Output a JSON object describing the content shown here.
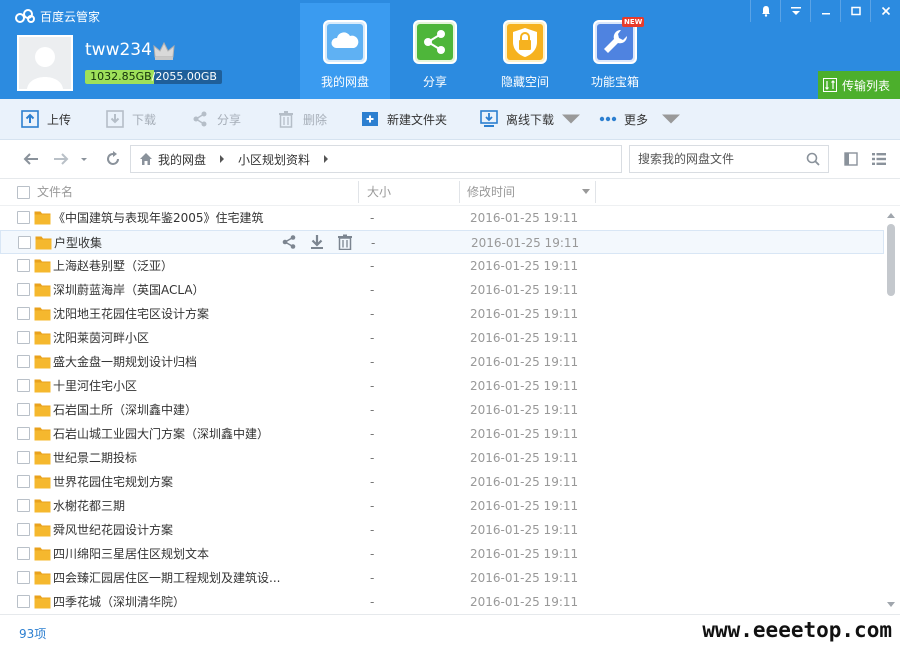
{
  "app": {
    "title": "百度云管家"
  },
  "user": {
    "name": "tww234",
    "quota_used": "1032.85GB",
    "quota_total": "/2055.00GB",
    "quota_fraction": 0.5026
  },
  "nav_tabs": [
    {
      "label": "我的网盘",
      "icon": "cloud-icon",
      "active": true
    },
    {
      "label": "分享",
      "icon": "share-icon",
      "active": false
    },
    {
      "label": "隐藏空间",
      "icon": "lock-icon",
      "active": false
    },
    {
      "label": "功能宝箱",
      "icon": "wrench-icon",
      "active": false,
      "badge": "NEW"
    }
  ],
  "transfer": {
    "label": "传输列表"
  },
  "toolbar": {
    "upload": "上传",
    "download": "下载",
    "share": "分享",
    "delete": "删除",
    "new_folder": "新建文件夹",
    "offline_download": "离线下载",
    "more": "更多"
  },
  "breadcrumb": {
    "root": "我的网盘",
    "current": "小区规划资料"
  },
  "search": {
    "placeholder": "搜索我的网盘文件"
  },
  "columns": {
    "name": "文件名",
    "size": "大小",
    "modified": "修改时间"
  },
  "files": [
    {
      "name": "《中国建筑与表现年鉴2005》住宅建筑",
      "size": "-",
      "modified": "2016-01-25 19:11"
    },
    {
      "name": "户型收集",
      "size": "-",
      "modified": "2016-01-25 19:11"
    },
    {
      "name": "上海赵巷别墅（泛亚）",
      "size": "-",
      "modified": "2016-01-25 19:11"
    },
    {
      "name": "深圳蔚蓝海岸（英国ACLA）",
      "size": "-",
      "modified": "2016-01-25 19:11"
    },
    {
      "name": "沈阳地王花园住宅区设计方案",
      "size": "-",
      "modified": "2016-01-25 19:11"
    },
    {
      "name": "沈阳莱茵河畔小区",
      "size": "-",
      "modified": "2016-01-25 19:11"
    },
    {
      "name": "盛大金盘一期规划设计归档",
      "size": "-",
      "modified": "2016-01-25 19:11"
    },
    {
      "name": "十里河住宅小区",
      "size": "-",
      "modified": "2016-01-25 19:11"
    },
    {
      "name": "石岩国土所（深圳鑫中建）",
      "size": "-",
      "modified": "2016-01-25 19:11"
    },
    {
      "name": "石岩山城工业园大门方案（深圳鑫中建）",
      "size": "-",
      "modified": "2016-01-25 19:11"
    },
    {
      "name": "世纪景二期投标",
      "size": "-",
      "modified": "2016-01-25 19:11"
    },
    {
      "name": "世界花园住宅规划方案",
      "size": "-",
      "modified": "2016-01-25 19:11"
    },
    {
      "name": "水榭花都三期",
      "size": "-",
      "modified": "2016-01-25 19:11"
    },
    {
      "name": "舜风世纪花园设计方案",
      "size": "-",
      "modified": "2016-01-25 19:11"
    },
    {
      "name": "四川绵阳三星居住区规划文本",
      "size": "-",
      "modified": "2016-01-25 19:11"
    },
    {
      "name": "四会臻汇园居住区一期工程规划及建筑设...",
      "size": "-",
      "modified": "2016-01-25 19:11"
    },
    {
      "name": "四季花城（深圳清华院）",
      "size": "-",
      "modified": "2016-01-25 19:11"
    }
  ],
  "status": {
    "count": "93项"
  },
  "watermark": {
    "text": "www.eeeetop.com"
  },
  "colors": {
    "header": "#2c8be0",
    "active_tab": "#3a9bf0",
    "transfer": "#4caf2c",
    "folder": "#f5b82e",
    "link": "#2c7fd0"
  }
}
